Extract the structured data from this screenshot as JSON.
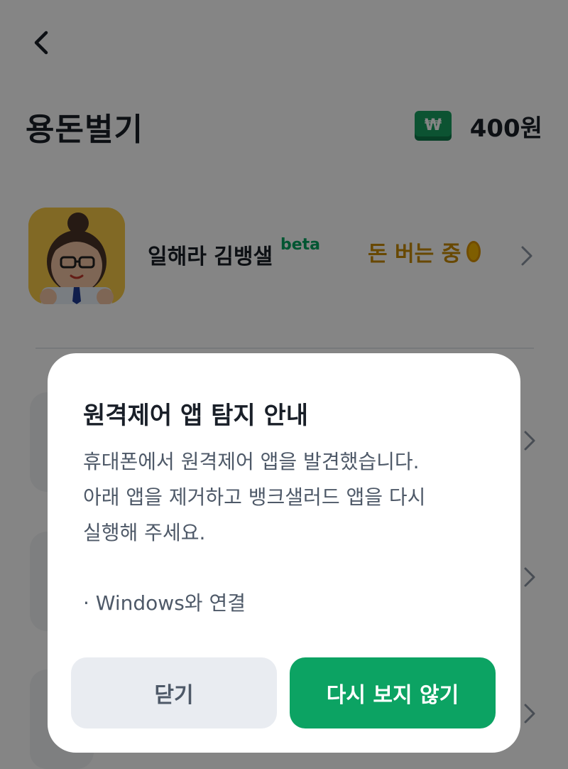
{
  "header": {
    "back_icon": "chevron-left-icon",
    "title": "용돈벌기",
    "balance_icon": "won-bill-icon",
    "balance": "400원"
  },
  "feature": {
    "name": "일해라 김뱅샐",
    "badge": "beta",
    "status": "돈 버는 중",
    "status_icon": "coin-icon",
    "arrow_icon": "chevron-right-icon"
  },
  "dialog": {
    "title": "원격제어 앱 탐지 안내",
    "body_lines": [
      "휴대폰에서 원격제어 앱을 발견했습니다.",
      "아래 앱을 제거하고 뱅크샐러드 앱을 다시",
      "실행해 주세요."
    ],
    "detected_app": "· Windows와 연결",
    "close_label": "닫기",
    "dont_show_label": "다시 보지 않기"
  },
  "colors": {
    "accent": "#0ca363",
    "beta": "#00a661",
    "earning": "#c78a00",
    "dim": "rgba(0,0,0,0.48)"
  }
}
